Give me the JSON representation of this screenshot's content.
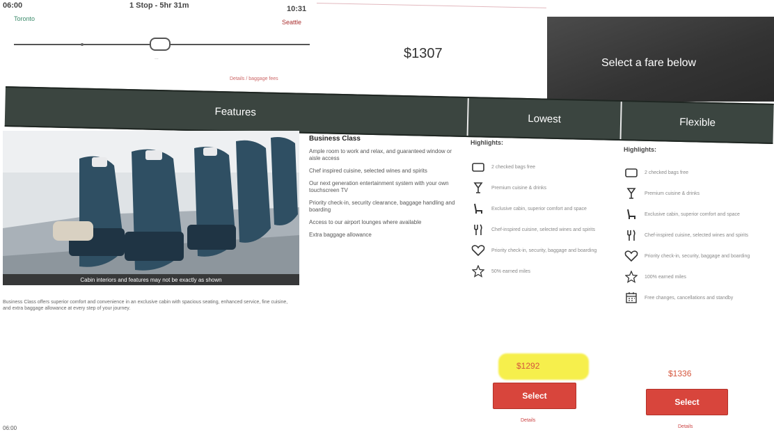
{
  "flight": {
    "depart_time": "06:00",
    "depart_airport": "Toronto",
    "stops": "1 Stop - 5hr 31m",
    "arrive_time": "10:31",
    "arrive_airport": "Seattle",
    "connection_caption": "...",
    "details_link": "Details / baggage fees"
  },
  "summary": {
    "price": "$1307",
    "select_prompt": "Select a fare below"
  },
  "header": {
    "features": "Features",
    "lowest": "Lowest",
    "flexible": "Flexible"
  },
  "cabin": {
    "photo_caption": "Cabin interiors and features may not be exactly as shown",
    "disclaimer": "Business Class offers superior comfort and convenience in an exclusive cabin with spacious seating, enhanced service, fine cuisine, and extra baggage allowance at every step of your journey."
  },
  "features": {
    "class_name": "Business Class",
    "items": [
      "Ample room to work and relax, and guaranteed window or aisle access",
      "Chef inspired cuisine, selected wines and spirits",
      "Our next generation entertainment system with your own touchscreen TV",
      "Priority check-in, security clearance, baggage handling and boarding",
      "Access to our airport lounges where available",
      "Extra baggage allowance"
    ]
  },
  "fares": {
    "lowest": {
      "highlights_title": "Highlights:",
      "highlights": [
        {
          "icon": "baggage-icon",
          "text": "2 checked bags free"
        },
        {
          "icon": "cocktail-icon",
          "text": "Premium cuisine & drinks"
        },
        {
          "icon": "seat-icon",
          "text": "Exclusive cabin, superior comfort and space"
        },
        {
          "icon": "dining-icon",
          "text": "Chef-inspired cuisine, selected wines and spirits"
        },
        {
          "icon": "heart-icon",
          "text": "Priority check-in, security, baggage and boarding"
        },
        {
          "icon": "star-icon",
          "text": "50% earned miles"
        }
      ],
      "price": "$1292",
      "select_label": "Select",
      "details_label": "Details"
    },
    "flexible": {
      "highlights_title": "Highlights:",
      "highlights": [
        {
          "icon": "baggage-icon",
          "text": "2 checked bags free"
        },
        {
          "icon": "cocktail-icon",
          "text": "Premium cuisine & drinks"
        },
        {
          "icon": "seat-icon",
          "text": "Exclusive cabin, superior comfort and space"
        },
        {
          "icon": "dining-icon",
          "text": "Chef-inspired cuisine, selected wines and spirits"
        },
        {
          "icon": "heart-icon",
          "text": "Priority check-in, security, baggage and boarding"
        },
        {
          "icon": "star-icon",
          "text": "100% earned miles"
        },
        {
          "icon": "calendar-icon",
          "text": "Free changes, cancellations and standby"
        }
      ],
      "price": "$1336",
      "select_label": "Select",
      "details_label": "Details"
    }
  },
  "footer": {
    "next_time": "06:00"
  }
}
